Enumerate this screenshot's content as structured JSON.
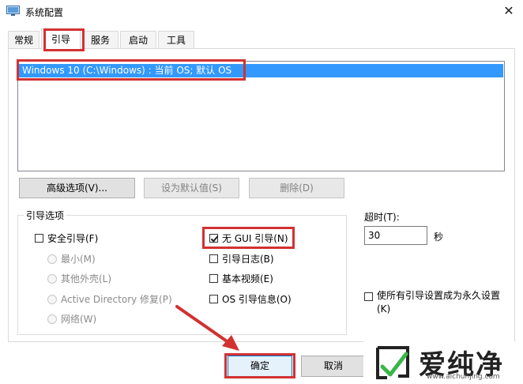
{
  "window": {
    "title": "系统配置",
    "close_glyph": "✕"
  },
  "tabs": [
    {
      "label": "常规"
    },
    {
      "label": "引导",
      "active": true
    },
    {
      "label": "服务"
    },
    {
      "label": "启动"
    },
    {
      "label": "工具"
    }
  ],
  "os_list": {
    "entries": [
      "Windows 10 (C:\\Windows) : 当前 OS; 默认 OS"
    ],
    "selected_index": 0
  },
  "list_buttons": {
    "advanced": "高级选项(V)...",
    "set_default": "设为默认值(S)",
    "delete": "删除(D)"
  },
  "boot_options": {
    "title": "引导选项",
    "safe_boot": {
      "label": "安全引导(F)",
      "checked": false
    },
    "radios": [
      "最小(M)",
      "其他外壳(L)",
      "Active Directory 修复(P)",
      "网络(W)"
    ],
    "no_gui_boot": {
      "label": "无 GUI 引导(N)",
      "checked": true
    },
    "boot_log": {
      "label": "引导日志(B)",
      "checked": false
    },
    "base_video": {
      "label": "基本视频(E)",
      "checked": false
    },
    "os_boot_info": {
      "label": "OS 引导信息(O)",
      "checked": false
    }
  },
  "timeout": {
    "label": "超时(T):",
    "value": "30",
    "unit": "秒"
  },
  "make_permanent": {
    "label": "使所有引导设置成为永久设置(K)",
    "checked": false
  },
  "dialog_buttons": {
    "ok": "确定",
    "cancel": "取消"
  },
  "watermark": {
    "brand": "爱纯净",
    "url": "www.aichunjing.com"
  },
  "colors": {
    "selection": "#3399ff",
    "highlight_box": "#d23131",
    "watermark_green": "#3bb54a"
  }
}
